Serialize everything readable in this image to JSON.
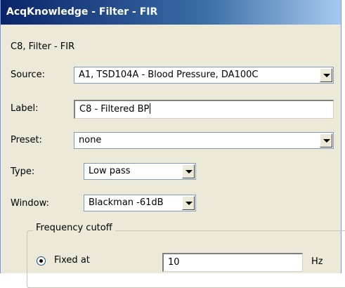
{
  "window": {
    "title": "AcqKnowledge - Filter - FIR"
  },
  "dialog": {
    "subtitle": "C8, Filter - FIR",
    "source": {
      "label": "Source:",
      "value": "A1, TSD104A - Blood Pressure, DA100C"
    },
    "label_field": {
      "label": "Label:",
      "value": "C8 - Filtered BP"
    },
    "preset": {
      "label": "Preset:",
      "value": "none"
    },
    "type": {
      "label": "Type:",
      "value": "Low pass"
    },
    "window_fn": {
      "label": "Window:",
      "value": "Blackman -61dB"
    },
    "frequency_cutoff": {
      "title": "Frequency cutoff",
      "fixed_at": {
        "label": "Fixed at",
        "value": "10",
        "unit": "Hz",
        "selected": true
      }
    }
  },
  "icons": {
    "dropdown": "chevron-down-icon",
    "radio": "radio-selected-icon"
  }
}
